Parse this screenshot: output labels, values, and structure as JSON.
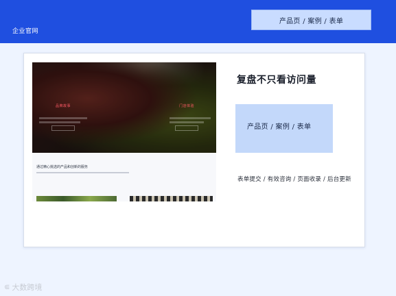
{
  "header": {
    "brand": "企业官网",
    "pill_label": "产品页 / 案例 / 表单"
  },
  "preview": {
    "hero": {
      "tag_left": "品牌故事",
      "tag_right": "门店体验"
    },
    "section_title": "通过精心挑选的产品和创新的服务"
  },
  "side": {
    "headline": "复盘不只看访问量",
    "box_label": "产品页 / 案例 / 表单",
    "metrics": "表单提交 / 有效咨询 / 页面收录 / 后台更新"
  },
  "watermark": {
    "text": "大数跨境",
    "icon": "logo-mark-icon"
  },
  "colors": {
    "header_bg": "#1f4fe0",
    "pill_bg": "#c9dcff",
    "box_bg": "#c3d8fa",
    "page_bg": "#eef4ff",
    "hero_accent": "#ff5a66"
  }
}
